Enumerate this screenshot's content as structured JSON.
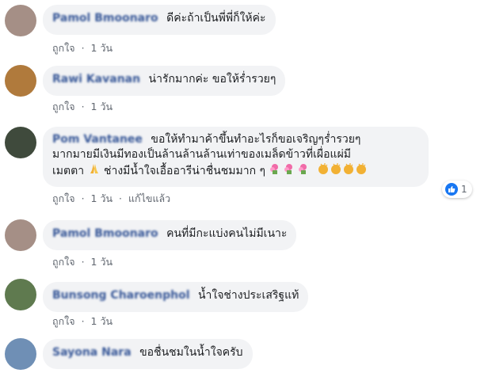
{
  "comments": [
    {
      "name": "Pamol Bmoonaro",
      "text": "ดีค่ะถ้าเป็นพี่พี่ก็ให้ค่ะ",
      "like": "ถูกใจ",
      "time": "1 วัน"
    },
    {
      "name": "Rawi Kavanan",
      "text": "น่ารักมากค่ะ ขอให้ร่ำรวยๆ",
      "like": "ถูกใจ",
      "time": "1 วัน"
    },
    {
      "name": "Pom Vantanee",
      "line1": "ขอให้ทำมาค้าขึ้นทำอะไรก็ขอเจริญๆร่ำรวยๆ",
      "line2": "มากมายมีเงินมีทองเป็นล้านล้านล้านเท่าของเมล็ดข้าวที่เผื่อแผ่มี",
      "line3": "เมตตา",
      "line4": "ช่างมีน้ำใจเอื้ออารีน่าชื่นชมมาก ๆ",
      "like": "ถูกใจ",
      "time": "1 วัน",
      "edited": "แก้ไขแล้ว",
      "reaction_count": "1"
    },
    {
      "name": "Pamol Bmoonaro",
      "text": "คนที่มีกะแบ่งคนไม่มีเนาะ",
      "like": "ถูกใจ",
      "time": "1 วัน"
    },
    {
      "name": "Bunsong Charoenphol",
      "text": "น้ำใจช่างประเสริฐแท้",
      "like": "ถูกใจ",
      "time": "1 วัน"
    },
    {
      "name": "Sayona Nara",
      "text": "ขอชื่นชมในน้ำใจครับ"
    }
  ],
  "colors": {
    "name": "#385898",
    "bubble": "#f2f3f5",
    "like_reaction": "#1877f2"
  }
}
